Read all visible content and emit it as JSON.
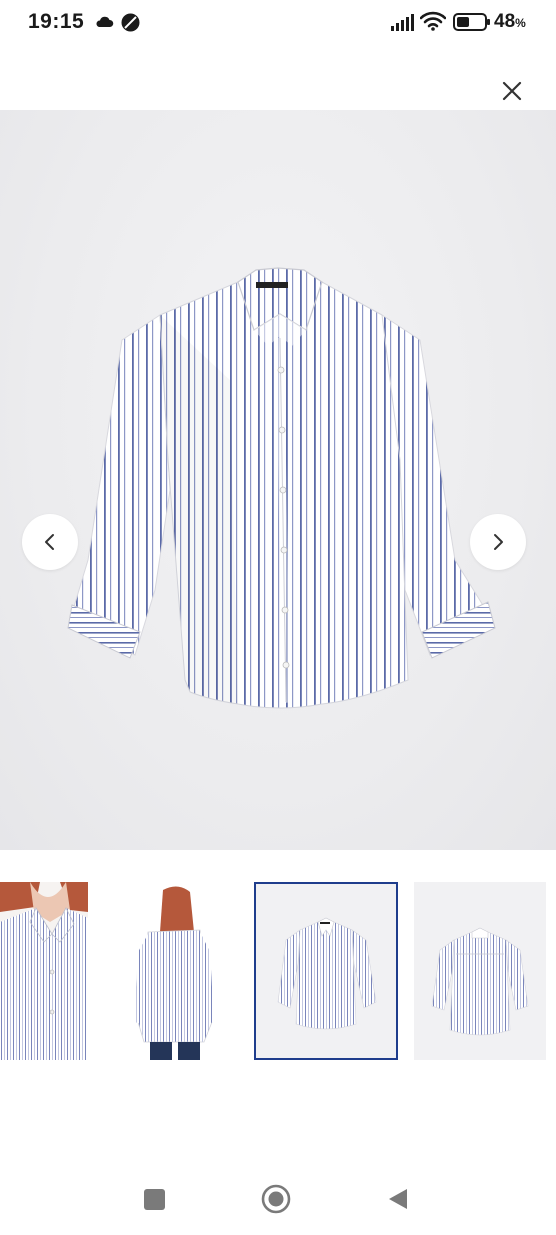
{
  "status_bar": {
    "time": "19:15",
    "battery_number": "48",
    "battery_unit": "%",
    "battery_level": 0.48
  },
  "viewer": {
    "close_icon": "close-icon",
    "prev_icon": "chevron-left-icon",
    "next_icon": "chevron-right-icon",
    "selected_thumbnail": 3,
    "accent_color": "#1f3d8c"
  },
  "thumbnails": [
    {
      "name": "model-collar-closeup"
    },
    {
      "name": "model-back-view"
    },
    {
      "name": "shirt-front-flat"
    },
    {
      "name": "shirt-back-flat"
    }
  ],
  "android_nav": {
    "recents_icon": "square-icon",
    "home_icon": "circle-icon",
    "back_icon": "triangle-back-icon"
  }
}
